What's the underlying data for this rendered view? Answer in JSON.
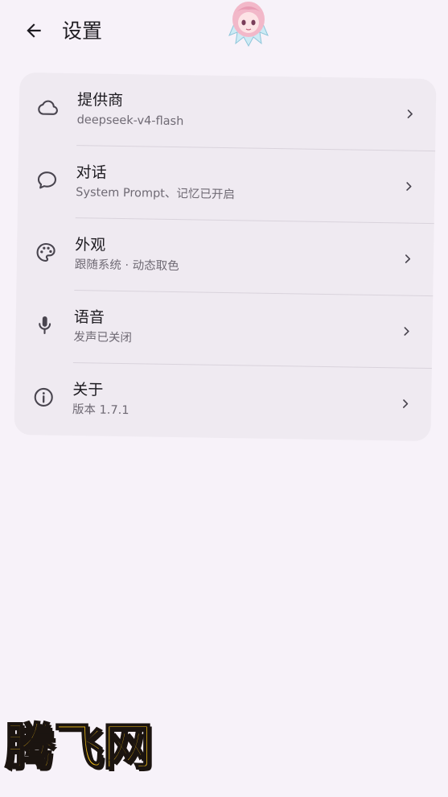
{
  "header": {
    "title": "设置",
    "back_icon": "arrow-left-icon"
  },
  "settings": {
    "items": [
      {
        "title": "提供商",
        "subtitle": "deepseek-v4-flash",
        "icon": "cloud-icon"
      },
      {
        "title": "对话",
        "subtitle": "System Prompt、记忆已开启",
        "icon": "chat-bubble-icon"
      },
      {
        "title": "外观",
        "subtitle": "跟随系统 · 动态取色",
        "icon": "palette-icon"
      },
      {
        "title": "语音",
        "subtitle": "发声已关闭",
        "icon": "microphone-icon"
      },
      {
        "title": "关于",
        "subtitle": "版本 1.7.1",
        "icon": "info-icon"
      }
    ]
  },
  "watermark": {
    "text": "腾飞网"
  },
  "colors": {
    "background": "#f7f2f9",
    "card": "#efeaf1",
    "text_primary": "#1d1b20",
    "text_secondary": "#6f6a74",
    "watermark_fill": "#f6c21a"
  }
}
